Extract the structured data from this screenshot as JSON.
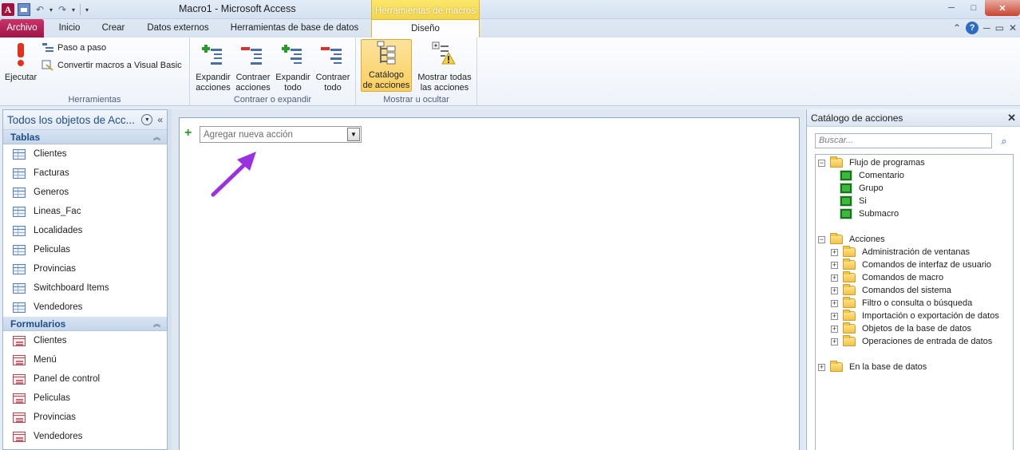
{
  "window": {
    "title": "Macro1  -  Microsoft Access",
    "contextual_group": "Herramientas de macros",
    "controls": {
      "minimize": "─",
      "maximize": "□",
      "close": "✕"
    }
  },
  "quick_access": {
    "app_icon": "A",
    "undo": "↶",
    "redo": "↷",
    "customize": "▾"
  },
  "tabs": {
    "file": "Archivo",
    "home": "Inicio",
    "create": "Crear",
    "external": "Datos externos",
    "db_tools": "Herramientas de base de datos",
    "design": "Diseño"
  },
  "ribbon_right": {
    "minimize_ribbon": "⌃",
    "help": "?",
    "restore": "▭",
    "close": "✕"
  },
  "ribbon": {
    "tools": {
      "label": "Herramientas",
      "run": "Ejecutar",
      "step": "Paso a paso",
      "convert": "Convertir macros a Visual Basic"
    },
    "expand_collapse": {
      "label": "Contraer o expandir",
      "expand_actions": [
        "Expandir",
        "acciones"
      ],
      "collapse_actions": [
        "Contraer",
        "acciones"
      ],
      "expand_all": [
        "Expandir",
        "todo"
      ],
      "collapse_all": [
        "Contraer",
        "todo"
      ]
    },
    "show_hide": {
      "label": "Mostrar u ocultar",
      "catalog": [
        "Catálogo",
        "de acciones"
      ],
      "show_all": [
        "Mostrar todas",
        "las acciones"
      ]
    }
  },
  "nav": {
    "title": "Todos los objetos de Acc...",
    "dropdown": "▼",
    "collapse": "«",
    "sections": [
      {
        "name": "Tablas",
        "chevron": "︽",
        "items": [
          "Clientes",
          "Facturas",
          "Generos",
          "Lineas_Fac",
          "Localidades",
          "Peliculas",
          "Provincias",
          "Switchboard Items",
          "Vendedores"
        ]
      },
      {
        "name": "Formularios",
        "chevron": "︽",
        "items": [
          "Clientes",
          "Menú",
          "Panel de control",
          "Peliculas",
          "Provincias",
          "Vendedores"
        ]
      }
    ]
  },
  "designer": {
    "add_plus": "+",
    "add_action_placeholder": "Agregar nueva acción",
    "combo_arrow": "▼"
  },
  "catalog": {
    "title": "Catálogo de acciones",
    "close": "✕",
    "search_placeholder": "Buscar...",
    "search_icon": "⌕",
    "flow": {
      "label": "Flujo de programas",
      "toggle": "−",
      "items": [
        "Comentario",
        "Grupo",
        "Si",
        "Submacro"
      ]
    },
    "actions": {
      "label": "Acciones",
      "toggle": "−",
      "items": [
        "Administración de ventanas",
        "Comandos de interfaz de usuario",
        "Comandos de macro",
        "Comandos del sistema",
        "Filtro o consulta o búsqueda",
        "Importación o exportación de datos",
        "Objetos de la base de datos",
        "Operaciones de entrada de datos"
      ]
    },
    "in_db": {
      "label": "En la base de datos",
      "toggle": "+"
    },
    "item_toggle": "+"
  },
  "colors": {
    "file_tab": "#a11546",
    "contextual": "#f4d447",
    "accent": "#1f4e8c",
    "annotation_arrow": "#9b30e0"
  }
}
